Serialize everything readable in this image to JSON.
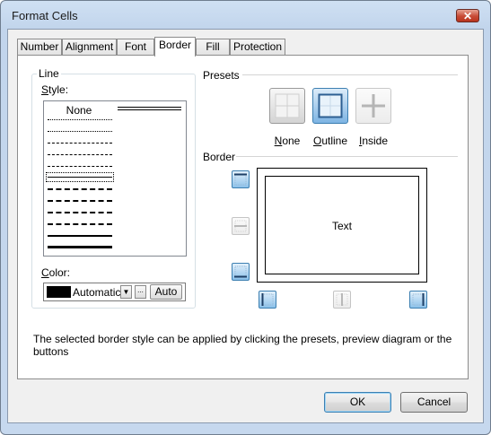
{
  "window": {
    "title": "Format Cells",
    "close_glyph": "✕"
  },
  "tabs": [
    {
      "label": "Number",
      "active": false
    },
    {
      "label": "Alignment",
      "active": false
    },
    {
      "label": "Font",
      "active": false
    },
    {
      "label": "Border",
      "active": true
    },
    {
      "label": "Fill",
      "active": false
    },
    {
      "label": "Protection",
      "active": false
    }
  ],
  "line": {
    "group_title": "Line",
    "style_label_first": "S",
    "style_label_rest": "tyle:",
    "none_label": "None",
    "selected_style_index": 7,
    "color_label_first": "C",
    "color_label_rest": "olor:",
    "color_value": "Automatic",
    "color_swatch": "#000000",
    "dropdown_glyph": "▼",
    "more_glyph": "...",
    "auto_label": "Auto"
  },
  "presets": {
    "title": "Presets",
    "items": [
      {
        "first": "N",
        "rest": "one",
        "icon": "preset-none-icon"
      },
      {
        "first": "O",
        "rest": "utline",
        "icon": "preset-outline-icon"
      },
      {
        "first": "I",
        "rest": "nside",
        "icon": "preset-inside-icon"
      }
    ]
  },
  "border": {
    "title": "Border",
    "preview_text": "Text",
    "buttons": [
      {
        "name": "border-top-button",
        "icon": "border-top-icon",
        "on": true
      },
      {
        "name": "border-inside-horizontal-button",
        "icon": "border-inside-horizontal-icon",
        "on": false
      },
      {
        "name": "border-bottom-button",
        "icon": "border-bottom-icon",
        "on": true
      },
      {
        "name": "border-left-button",
        "icon": "border-left-icon",
        "on": true
      },
      {
        "name": "border-inside-vertical-button",
        "icon": "border-inside-vertical-icon",
        "on": false
      },
      {
        "name": "border-right-button",
        "icon": "border-right-icon",
        "on": true
      }
    ]
  },
  "hint": "The selected border style can be applied by clicking the presets, preview diagram or the buttons",
  "buttons": {
    "ok": "OK",
    "cancel": "Cancel"
  },
  "colors": {
    "accent": "#3c7fb1",
    "title_bar": "#c6d8ee",
    "close": "#c74a35"
  }
}
